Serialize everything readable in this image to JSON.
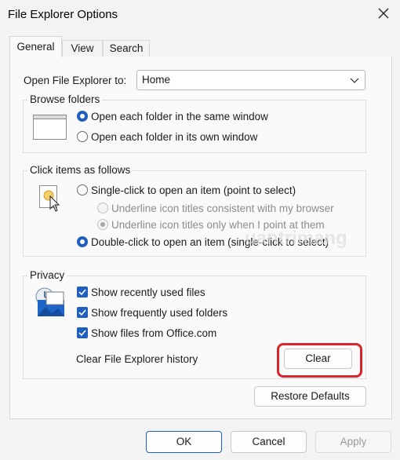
{
  "window": {
    "title": "File Explorer Options"
  },
  "tabs": [
    {
      "label": "General",
      "active": true
    },
    {
      "label": "View",
      "active": false
    },
    {
      "label": "Search",
      "active": false
    }
  ],
  "open_to": {
    "label": "Open File Explorer to:",
    "value": "Home"
  },
  "browse": {
    "legend": "Browse folders",
    "options": [
      {
        "label": "Open each folder in the same window",
        "selected": true
      },
      {
        "label": "Open each folder in its own window",
        "selected": false
      }
    ]
  },
  "click": {
    "legend": "Click items as follows",
    "single": "Single-click to open an item (point to select)",
    "sub": [
      "Underline icon titles consistent with my browser",
      "Underline icon titles only when I point at them"
    ],
    "double": "Double-click to open an item (single-click to select)"
  },
  "privacy": {
    "legend": "Privacy",
    "checks": [
      {
        "label": "Show recently used files",
        "checked": true
      },
      {
        "label": "Show frequently used folders",
        "checked": true
      },
      {
        "label": "Show files from Office.com",
        "checked": true
      }
    ],
    "clear_label": "Clear File Explorer history",
    "clear_button": "Clear"
  },
  "restore_button": "Restore Defaults",
  "buttons": {
    "ok": "OK",
    "cancel": "Cancel",
    "apply": "Apply"
  },
  "watermark": "uantrimang",
  "colors": {
    "accent": "#1f5fbf",
    "highlight": "#d9262b"
  }
}
